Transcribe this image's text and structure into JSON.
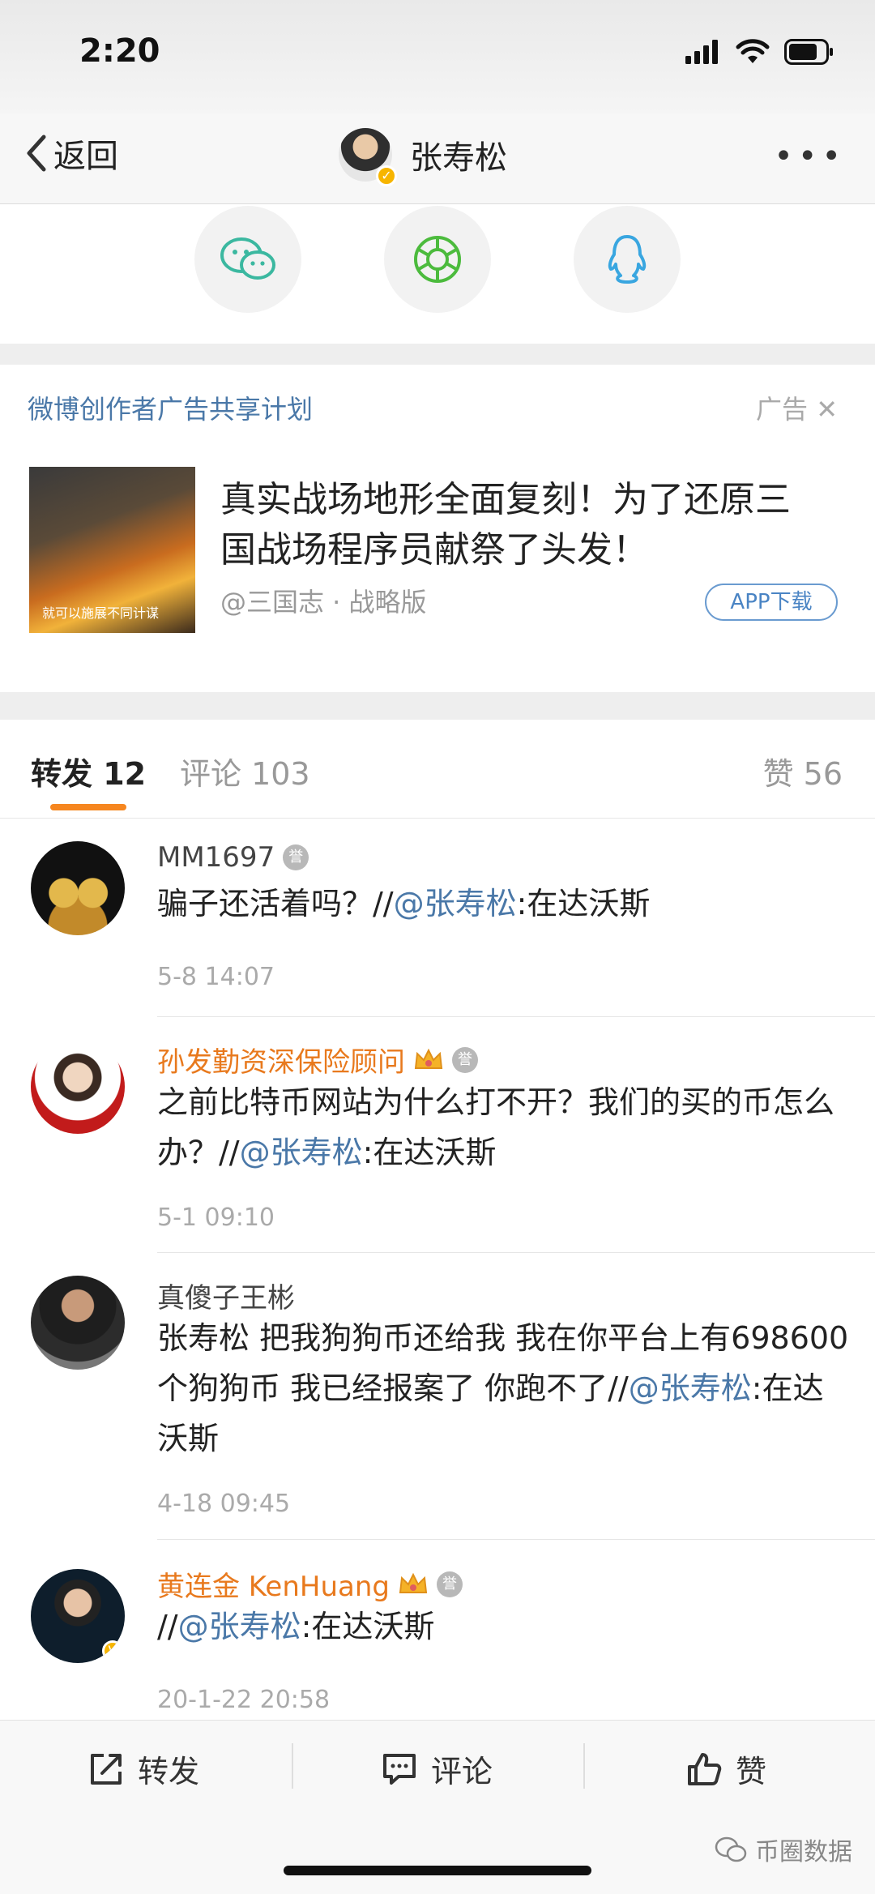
{
  "status_bar": {
    "time": "2:20"
  },
  "nav": {
    "back_label": "返回",
    "title": "张寿松"
  },
  "share": {
    "items": [
      "wechat-icon",
      "moments-icon",
      "qq-icon"
    ]
  },
  "ad": {
    "program": "微博创作者广告共享计划",
    "tag": "广告",
    "thumb_caption": "就可以施展不同计谋",
    "title": "真实战场地形全面复刻！为了还原三国战场程序员献祭了头发！",
    "source": "@三国志 · 战略版",
    "button": "APP下载"
  },
  "tabs": {
    "repost": "转发 12",
    "comment": "评论 103",
    "like": "赞 56"
  },
  "reposts": [
    {
      "user": "MM1697",
      "text": "骗子还活着吗？//",
      "mention": "@张寿松",
      "suffix": ":在达沃斯",
      "time": "5-8 14:07"
    },
    {
      "user": "孙发勤资深保险顾问",
      "text": "之前比特币网站为什么打不开？我们的买的币怎么办？//",
      "mention": "@张寿松",
      "suffix": ":在达沃斯",
      "time": "5-1 09:10"
    },
    {
      "user": "真傻子王彬",
      "text": "张寿松 把我狗狗币还给我 我在你平台上有698600个狗狗币 我已经报案了 你跑不了//",
      "mention": "@张寿松",
      "suffix": ":在达沃斯",
      "time": "4-18 09:45"
    },
    {
      "user": "黄连金 KenHuang",
      "text": "//",
      "mention": "@张寿松",
      "suffix": ":在达沃斯",
      "time": "20-1-22 20:58"
    }
  ],
  "bottom_bar": {
    "repost": "转发",
    "comment": "评论",
    "like": "赞"
  },
  "watermark": "币圈数据",
  "colors": {
    "accent": "#f6861f",
    "link": "#4a78a8",
    "vip_name": "#e8791d"
  }
}
